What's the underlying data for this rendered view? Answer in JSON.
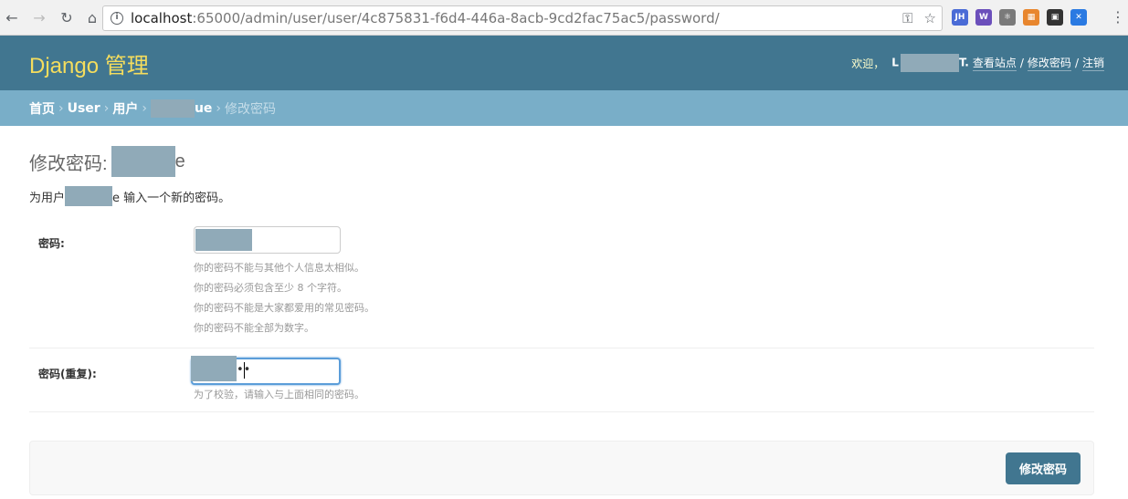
{
  "browser": {
    "url_host": "localhost",
    "url_path": ":65000/admin/user/user/4c875831-f6d4-446a-8acb-9cd2fac75ac5/password/",
    "extensions": [
      {
        "name": "jh-extension-icon",
        "label": "JH",
        "color": "#4a6bd6"
      },
      {
        "name": "wa-extension-icon",
        "label": "W",
        "color": "#6b4fbb"
      },
      {
        "name": "react-devtools-icon",
        "label": "⚛",
        "color": "#7a7a7a"
      },
      {
        "name": "grid-extension-icon",
        "label": "▦",
        "color": "#e8862e"
      },
      {
        "name": "qr-code-icon",
        "label": "▣",
        "color": "#333333"
      },
      {
        "name": "blue-extension-icon",
        "label": "✕",
        "color": "#2a7ae2"
      }
    ]
  },
  "header": {
    "brand": "Django 管理",
    "welcome": "欢迎，",
    "user_initial": "L",
    "user_tail": "T.",
    "links": {
      "view_site": "查看站点",
      "change_password": "修改密码",
      "logout": "注销"
    },
    "separator": "/"
  },
  "breadcrumbs": {
    "home": "首页",
    "app": "User",
    "model": "用户",
    "object_tail": "ue",
    "current": "修改密码",
    "arrow": "›"
  },
  "page": {
    "title_prefix": "修改密码:",
    "title_tail": "e",
    "intro_prefix": "为用户",
    "intro_tail": "e 输入一个新的密码。"
  },
  "form": {
    "password1": {
      "label": "密码:",
      "help": [
        "你的密码不能与其他个人信息太相似。",
        "你的密码必须包含至少 8 个字符。",
        "你的密码不能是大家都爱用的常见密码。",
        "你的密码不能全部为数字。"
      ]
    },
    "password2": {
      "label": "密码(重复):",
      "value_tail": "••",
      "help": "为了校验，请输入与上面相同的密码。"
    },
    "submit_label": "修改密码"
  },
  "colors": {
    "header_bg": "#417690",
    "brand": "#f5dd5d",
    "breadcrumbs_bg": "#79aec8",
    "redaction": "#90aab8"
  }
}
